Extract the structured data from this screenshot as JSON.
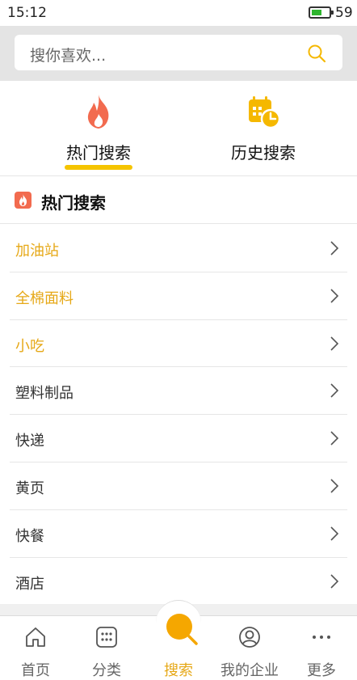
{
  "status_bar": {
    "time": "15:12",
    "battery_level": "59",
    "battery_fraction": 0.59
  },
  "search": {
    "placeholder": "搜你喜欢...",
    "icon": "search-icon"
  },
  "tabs": [
    {
      "label": "热门搜索",
      "icon": "flame-icon",
      "active": true
    },
    {
      "label": "历史搜索",
      "icon": "calendar-clock-icon",
      "active": false
    }
  ],
  "section": {
    "title": "热门搜索",
    "icon": "flame-icon"
  },
  "hot_list": [
    {
      "label": "加油站",
      "highlight": true
    },
    {
      "label": "全棉面料",
      "highlight": true
    },
    {
      "label": "小吃",
      "highlight": true
    },
    {
      "label": "塑料制品",
      "highlight": false
    },
    {
      "label": "快递",
      "highlight": false
    },
    {
      "label": "黄页",
      "highlight": false
    },
    {
      "label": "快餐",
      "highlight": false
    },
    {
      "label": "酒店",
      "highlight": false
    }
  ],
  "bottom_nav": [
    {
      "label": "首页",
      "icon": "home-icon",
      "active": false
    },
    {
      "label": "分类",
      "icon": "grid-icon",
      "active": false
    },
    {
      "label": "搜索",
      "icon": "search-icon",
      "active": true
    },
    {
      "label": "我的企业",
      "icon": "user-icon",
      "active": false
    },
    {
      "label": "更多",
      "icon": "more-icon",
      "active": false
    }
  ],
  "colors": {
    "accent": "#e6a817",
    "underline": "#f5c400",
    "flame": "#f26b4f",
    "battery": "#2fb52f"
  }
}
